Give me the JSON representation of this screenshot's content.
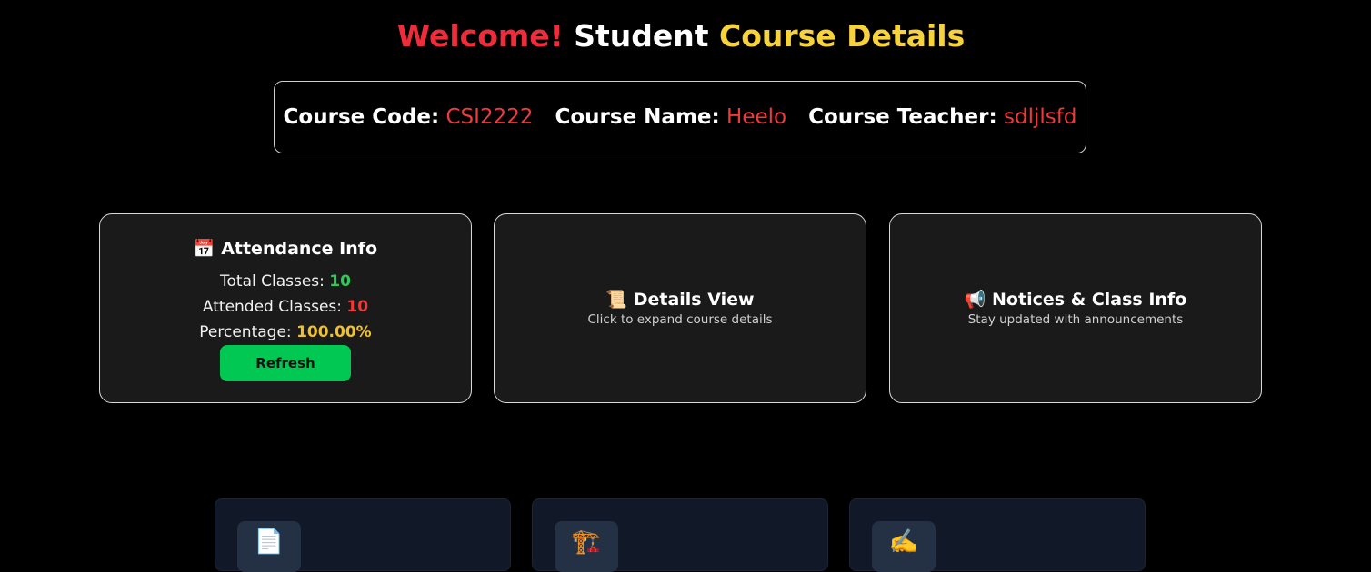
{
  "title": {
    "part1": "Welcome!",
    "part2": "Student",
    "part3": "Course Details"
  },
  "course": {
    "code_label": "Course Code:",
    "code": "CSI2222",
    "name_label": "Course Name:",
    "name": "Heelo",
    "teacher_label": "Course Teacher:",
    "teacher": "sdljlsfd"
  },
  "attendance": {
    "icon": "📅",
    "heading": "Attendance Info",
    "total_label": "Total Classes:",
    "total": "10",
    "attended_label": "Attended Classes:",
    "attended": "10",
    "percentage_label": "Percentage:",
    "percentage": "100.00%",
    "refresh_label": "Refresh"
  },
  "details": {
    "icon": "📜",
    "heading": "Details View",
    "sub": "Click to expand course details"
  },
  "notices": {
    "icon": "📢",
    "heading": "Notices & Class Info",
    "sub": "Stay updated with announcements"
  },
  "tiles": [
    {
      "icon": "📄",
      "icon_name": "document-icon"
    },
    {
      "icon": "🏗️",
      "icon_name": "crane-icon"
    },
    {
      "icon": "✍️",
      "icon_name": "writing-hand-icon"
    }
  ],
  "colors": {
    "accent_red": "#ef2d3a",
    "accent_yellow": "#f7d23a",
    "accent_green": "#00c853"
  }
}
